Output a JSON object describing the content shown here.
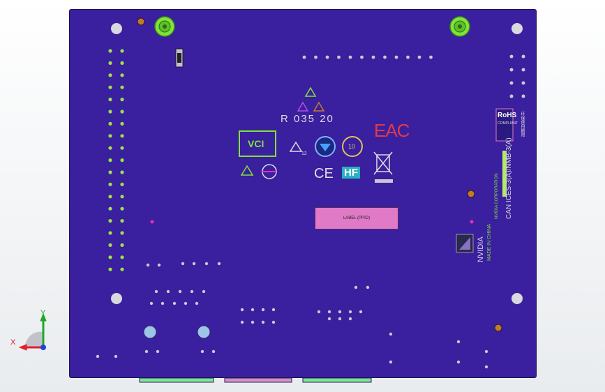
{
  "board_marks": {
    "label_box_text": "LABEL (PPID)",
    "date_code": "R 035 20",
    "vci_text": "VCI",
    "ce_text": "CE",
    "hf_text": "HF",
    "eac_text": "EAC",
    "recycle_number": "10",
    "ukca_subtext": "12",
    "rohs_title": "RoHS",
    "rohs_subtext": "COMPLIANT",
    "nvidia_text": "NVIDIA",
    "made_in_text": "MADE IN CHINA",
    "can_ices_text": "CAN ICES-3(A)/NMB-3(A)",
    "chinese_mark": "环保使用期限",
    "nvidia_corp_text": "NVIDIA CORPORATION"
  },
  "triad": {
    "x_label": "X",
    "y_label": "Y",
    "x_color": "#e0202a",
    "y_color": "#1ea82a",
    "z_color": "#2040e0"
  },
  "colors": {
    "board": "#3a1f9e",
    "pad_green": "#9be24a",
    "label_pink": "#e07ac6",
    "mount_hole": "#d8d8e0",
    "standoff": "#7fe33a"
  }
}
